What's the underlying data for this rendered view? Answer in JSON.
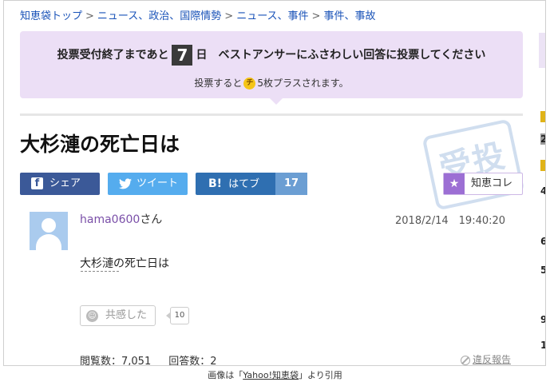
{
  "breadcrumb": {
    "items": [
      "知恵袋トップ",
      "ニュース、政治、国際情勢",
      "ニュース、事件",
      "事件、事故"
    ],
    "separator": ">"
  },
  "vote": {
    "prefix": "投票受付終了まであと",
    "days": "7",
    "suffix": "日　ベストアンサーにふさわしい回答に投票してください",
    "bonus_prefix": "投票すると",
    "coin_icon": "チ",
    "bonus_suffix": "5枚プラスされます。"
  },
  "question": {
    "title": "大杉漣の死亡日は",
    "stamp_text": "受投",
    "username": "hama0600",
    "honorific": "さん",
    "datetime": "2018/2/14　19:40:20",
    "body": "大杉漣の死亡日は"
  },
  "share": {
    "facebook_label": "シェア",
    "twitter_label": "ツイート",
    "hatena_label": "はてブ",
    "hatena_icon": "B!",
    "hatena_count": "17",
    "chiekore_label": "知恵コレ"
  },
  "empathy": {
    "label": "共感した",
    "count": "10"
  },
  "stats": {
    "views": "閲覧数：7,051",
    "answers": "回答数：2",
    "report_label": "違反報告"
  },
  "side": {
    "items": [
      "2",
      "4",
      "6",
      "5",
      "9",
      "1"
    ]
  },
  "caption": {
    "prefix": "画像は「",
    "link": "Yahoo!知恵袋",
    "suffix": "」より引用"
  },
  "colors": {
    "vote_bg": "#ecdff6",
    "facebook": "#3b5998",
    "twitter": "#55acee",
    "hatena": "#2f6fb1",
    "chiekore_accent": "#9c6fd4",
    "link": "#1a53b8"
  }
}
